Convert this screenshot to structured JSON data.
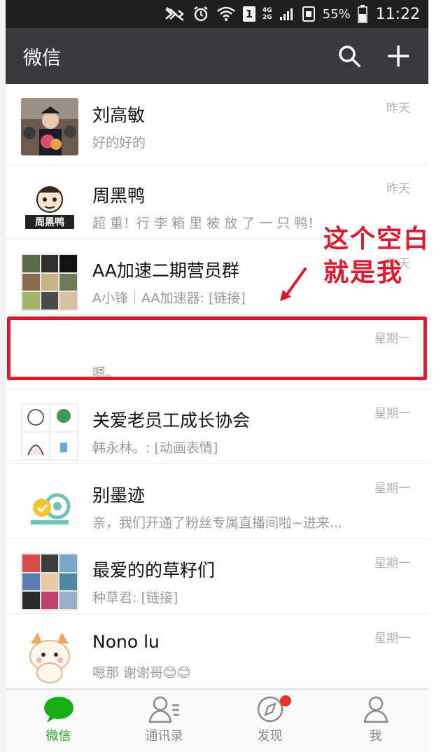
{
  "status_bar": {
    "network_top": "4G",
    "network_bottom": "2G",
    "sim_slot": "1",
    "battery": "55%",
    "time": "11:22"
  },
  "header": {
    "title": "微信",
    "search_icon": "search-icon",
    "add_icon": "plus-icon"
  },
  "chats": [
    {
      "name": "刘高敏",
      "preview": "好的好的",
      "time": "昨天"
    },
    {
      "name": "周黑鸭",
      "preview": "超 重！行 李 箱 里 被 放 了 一 只 鸭！",
      "time": "昨天"
    },
    {
      "name": "AA加速二期营员群",
      "preview": "A小锋｜AA加速器: [链接]",
      "time": "昨天"
    },
    {
      "name": "",
      "preview": "嗯。",
      "time": "星期一"
    },
    {
      "name": "关爱老员工成长协会",
      "preview": "韩永林。: [动画表情]",
      "time": "星期一"
    },
    {
      "name": "别墨迹",
      "preview": "亲，我们开通了粉丝专属直播间啦~进来...",
      "time": "星期一"
    },
    {
      "name": "最爱的的草籽们",
      "preview": "种草君: [链接]",
      "time": "星期一"
    },
    {
      "name": "Nono lu",
      "preview": "嗯那 谢谢哥😊😊",
      "time": "星期一"
    }
  ],
  "annotation": {
    "line1": "这个空白",
    "line2": "就是我",
    "color": "#e0182d"
  },
  "bottom_nav": [
    {
      "label": "微信",
      "icon": "chat-bubble-icon",
      "active": true
    },
    {
      "label": "通讯录",
      "icon": "contacts-icon",
      "active": false
    },
    {
      "label": "发现",
      "icon": "compass-icon",
      "active": false,
      "badge": true
    },
    {
      "label": "我",
      "icon": "person-icon",
      "active": false
    }
  ],
  "colors": {
    "header_bg": "#393a3f",
    "accent_green": "#1aad19",
    "badge_red": "#e8332a"
  }
}
